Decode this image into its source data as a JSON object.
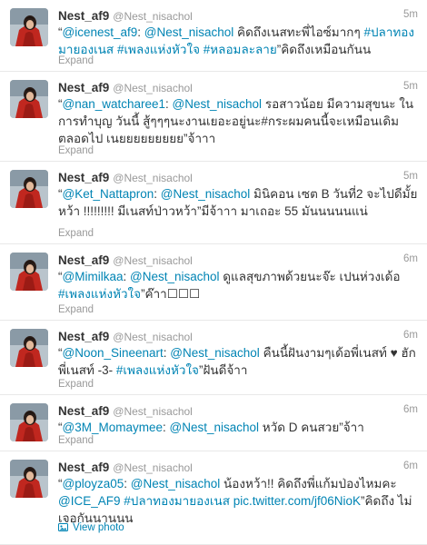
{
  "colors": {
    "link": "#0084b4",
    "muted": "#999999",
    "text": "#333333",
    "divider": "#e8e8e8"
  },
  "tweets": [
    {
      "name": "Nest_af9",
      "handle": "@Nest_nisachol",
      "time": "5m",
      "segments": [
        {
          "text": "“",
          "link": false
        },
        {
          "text": "@icenest_af9",
          "link": true
        },
        {
          "text": ": ",
          "link": false
        },
        {
          "text": "@Nest_nisachol",
          "link": true
        },
        {
          "text": " คิดถึงเนสทะพี่ไอซ์มากๆ ",
          "link": false
        },
        {
          "text": "#ปลาทองมายองเนส",
          "link": true
        },
        {
          "text": " ",
          "link": false
        },
        {
          "text": "#เพลงแห่งหัวใจ",
          "link": true
        },
        {
          "text": " ",
          "link": false
        },
        {
          "text": "#หลอมละลาย",
          "link": true
        },
        {
          "text": "”คิดถึงเหมือนกันน",
          "link": false
        }
      ],
      "footer": "Expand",
      "footer_type": "expand"
    },
    {
      "name": "Nest_af9",
      "handle": "@Nest_nisachol",
      "time": "5m",
      "segments": [
        {
          "text": "“",
          "link": false
        },
        {
          "text": "@nan_watcharee1",
          "link": true
        },
        {
          "text": ": ",
          "link": false
        },
        {
          "text": "@Nest_nisachol",
          "link": true
        },
        {
          "text": " รอสาวน้อย มีความสุขนะ ในการทำบุญ วันนี้ สู้ๆๆๆนะงานเยอะอยู่นะ#กระผมคนนี้จะเหมือนเดิมตลอดไป เนยยยยยยยยย”จ้าาา",
          "link": false
        }
      ],
      "footer": "Expand",
      "footer_type": "expand"
    },
    {
      "name": "Nest_af9",
      "handle": "@Nest_nisachol",
      "time": "5m",
      "segments": [
        {
          "text": "“",
          "link": false
        },
        {
          "text": "@Ket_Nattapron",
          "link": true
        },
        {
          "text": ": ",
          "link": false
        },
        {
          "text": "@Nest_nisachol",
          "link": true
        },
        {
          "text": " มินิคอน เซต B วันที่2 จะไปดีมั้ยหว้า !!!!!!!!! มีเนสท์ป่าวหว้า”มีจ้าาา มาเถอะ 55 มันนนนนแน่",
          "link": false
        }
      ],
      "footer": "Expand",
      "footer_type": "expand"
    },
    {
      "name": "Nest_af9",
      "handle": "@Nest_nisachol",
      "time": "6m",
      "segments": [
        {
          "text": "“",
          "link": false
        },
        {
          "text": "@Mimilkaa",
          "link": true
        },
        {
          "text": ": ",
          "link": false
        },
        {
          "text": "@Nest_nisachol",
          "link": true
        },
        {
          "text": " ดูแลสุขภาพด้วยนะจ๊ะ เปนห่วงเด้อ ",
          "link": false
        },
        {
          "text": "#เพลงแห่งหัวใจ",
          "link": true
        },
        {
          "text": "”ค๊าา☐☐☐",
          "link": false
        }
      ],
      "footer": "Expand",
      "footer_type": "expand"
    },
    {
      "name": "Nest_af9",
      "handle": "@Nest_nisachol",
      "time": "6m",
      "segments": [
        {
          "text": "“",
          "link": false
        },
        {
          "text": "@Noon_Sineenart",
          "link": true
        },
        {
          "text": ": ",
          "link": false
        },
        {
          "text": "@Nest_nisachol",
          "link": true
        },
        {
          "text": " คืนนี้ฝันงามๆเด้อพี่เนสท์ ♥ ฮักพี่เนสท์ -3- ",
          "link": false
        },
        {
          "text": "#เพลงแห่งหัวใจ",
          "link": true
        },
        {
          "text": "”ฝันดีจ้าา",
          "link": false
        }
      ],
      "footer": "Expand",
      "footer_type": "expand"
    },
    {
      "name": "Nest_af9",
      "handle": "@Nest_nisachol",
      "time": "6m",
      "segments": [
        {
          "text": "“",
          "link": false
        },
        {
          "text": "@3M_Momaymee",
          "link": true
        },
        {
          "text": ": ",
          "link": false
        },
        {
          "text": "@Nest_nisachol",
          "link": true
        },
        {
          "text": " หวัด D คนสวย”จ้าา",
          "link": false
        }
      ],
      "footer": "Expand",
      "footer_type": "expand"
    },
    {
      "name": "Nest_af9",
      "handle": "@Nest_nisachol",
      "time": "6m",
      "segments": [
        {
          "text": "“",
          "link": false
        },
        {
          "text": "@ployza05",
          "link": true
        },
        {
          "text": ": ",
          "link": false
        },
        {
          "text": "@Nest_nisachol",
          "link": true
        },
        {
          "text": " น้องหว้า!! คิดถึงพี่แก้มป่องไหมคะ ",
          "link": false
        },
        {
          "text": "@ICE_AF9",
          "link": true
        },
        {
          "text": " ",
          "link": false
        },
        {
          "text": "#ปลาทองมายองเนส",
          "link": true
        },
        {
          "text": " ",
          "link": false
        },
        {
          "text": "pic.twitter.com/jf06NioK",
          "link": true
        },
        {
          "text": "”คิดถึง ไม่เจอกันนานนน",
          "link": false
        }
      ],
      "footer": "View photo",
      "footer_type": "photo"
    }
  ]
}
